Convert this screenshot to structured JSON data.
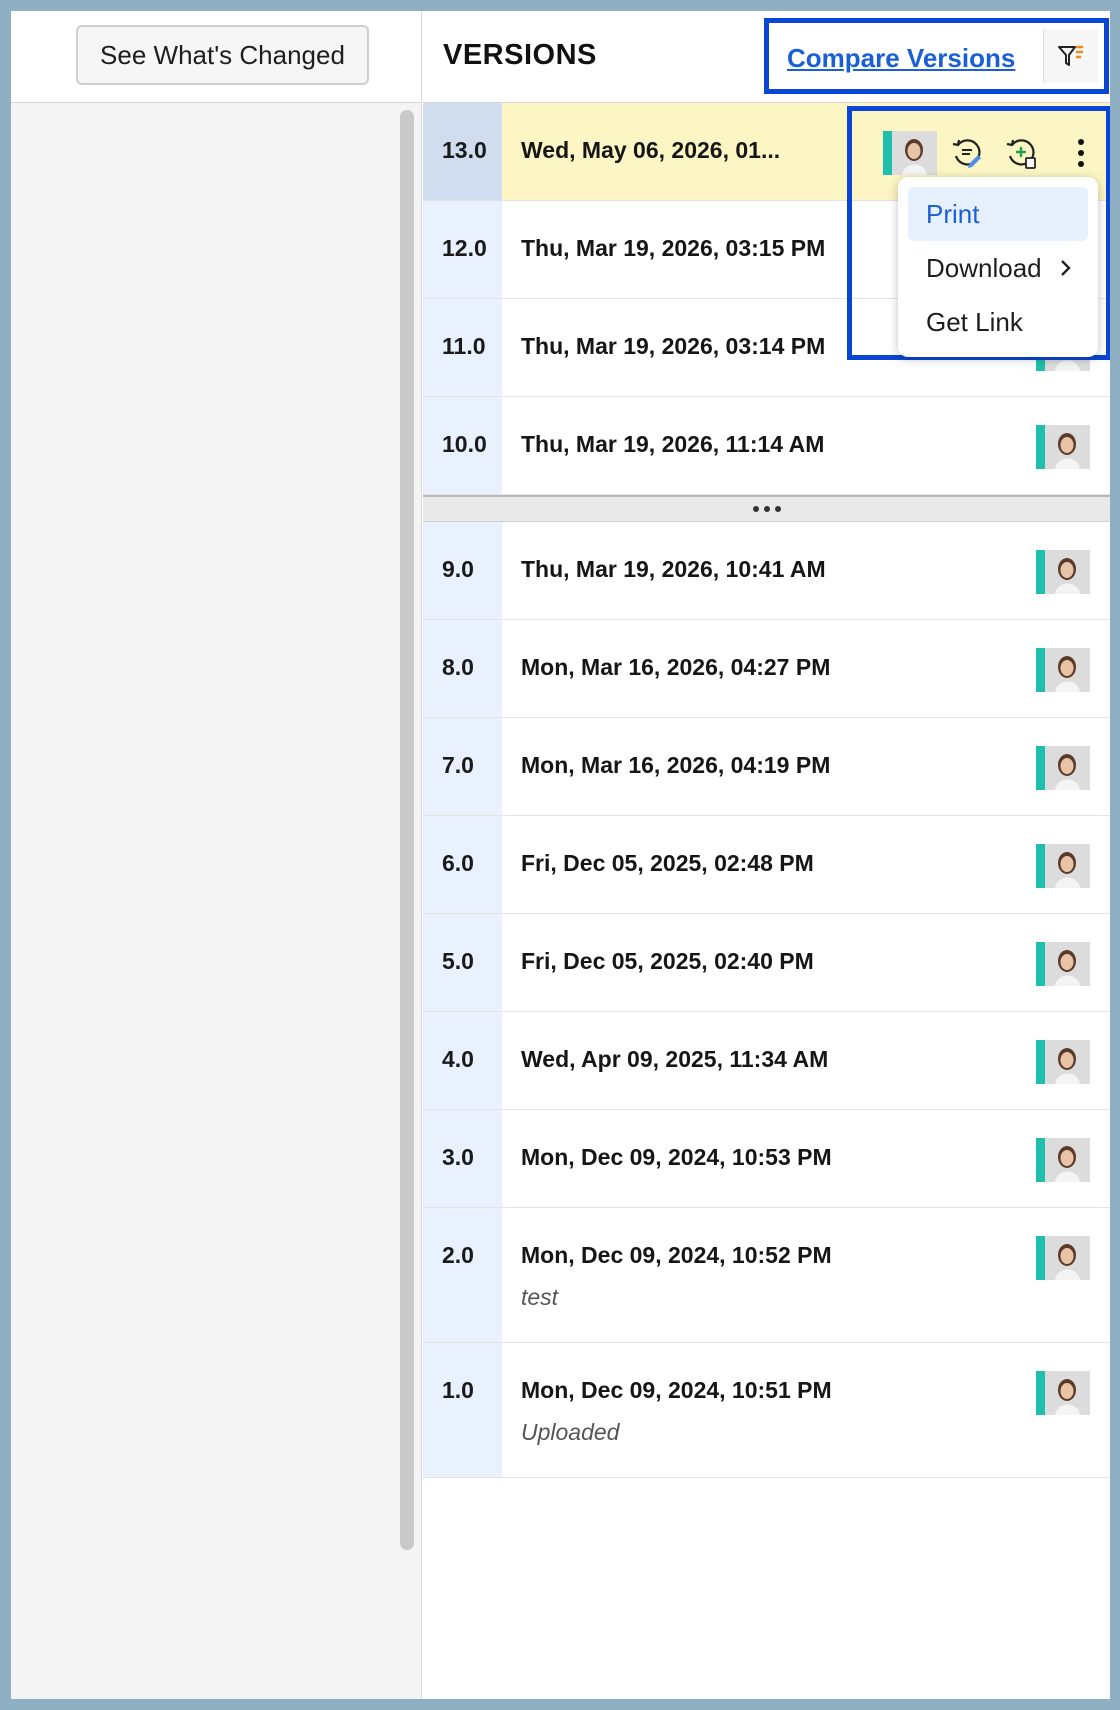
{
  "left": {
    "see_changed_label": "See What's Changed"
  },
  "header": {
    "title": "VERSIONS",
    "compare_label": "Compare Versions"
  },
  "colors": {
    "accent_blue": "#1a5fd8",
    "highlight_border": "#0a46d6",
    "avatar_bar": "#1fbfad",
    "selected_row": "#fcf6c4"
  },
  "versions_top": [
    {
      "num": "13.0",
      "date": "Wed, May 06, 2026, 01...",
      "selected": true
    },
    {
      "num": "12.0",
      "date": "Thu, Mar 19, 2026, 03:15 PM"
    },
    {
      "num": "11.0",
      "date": "Thu, Mar 19, 2026, 03:14 PM"
    },
    {
      "num": "10.0",
      "date": "Thu, Mar 19, 2026, 11:14 AM"
    }
  ],
  "versions_bottom": [
    {
      "num": "9.0",
      "date": "Thu, Mar 19, 2026, 10:41 AM"
    },
    {
      "num": "8.0",
      "date": "Mon, Mar 16, 2026, 04:27 PM"
    },
    {
      "num": "7.0",
      "date": "Mon, Mar 16, 2026, 04:19 PM"
    },
    {
      "num": "6.0",
      "date": "Fri, Dec 05, 2025, 02:48 PM"
    },
    {
      "num": "5.0",
      "date": "Fri, Dec 05, 2025, 02:40 PM"
    },
    {
      "num": "4.0",
      "date": "Wed, Apr 09, 2025, 11:34 AM"
    },
    {
      "num": "3.0",
      "date": "Mon, Dec 09, 2024, 10:53 PM"
    },
    {
      "num": "2.0",
      "date": "Mon, Dec 09, 2024, 10:52 PM",
      "note": "test"
    },
    {
      "num": "1.0",
      "date": "Mon, Dec 09, 2024, 10:51 PM",
      "note": "Uploaded"
    }
  ],
  "menu": {
    "items": [
      "Print",
      "Download",
      "Get Link"
    ],
    "active": "Print"
  },
  "icons": {
    "filter": "filter-icon",
    "restore": "restore-version-icon",
    "copy": "make-copy-icon",
    "more": "more-options-icon",
    "expand": "expand-dots-icon",
    "chevron": "chevron-right-icon",
    "avatar": "avatar"
  }
}
